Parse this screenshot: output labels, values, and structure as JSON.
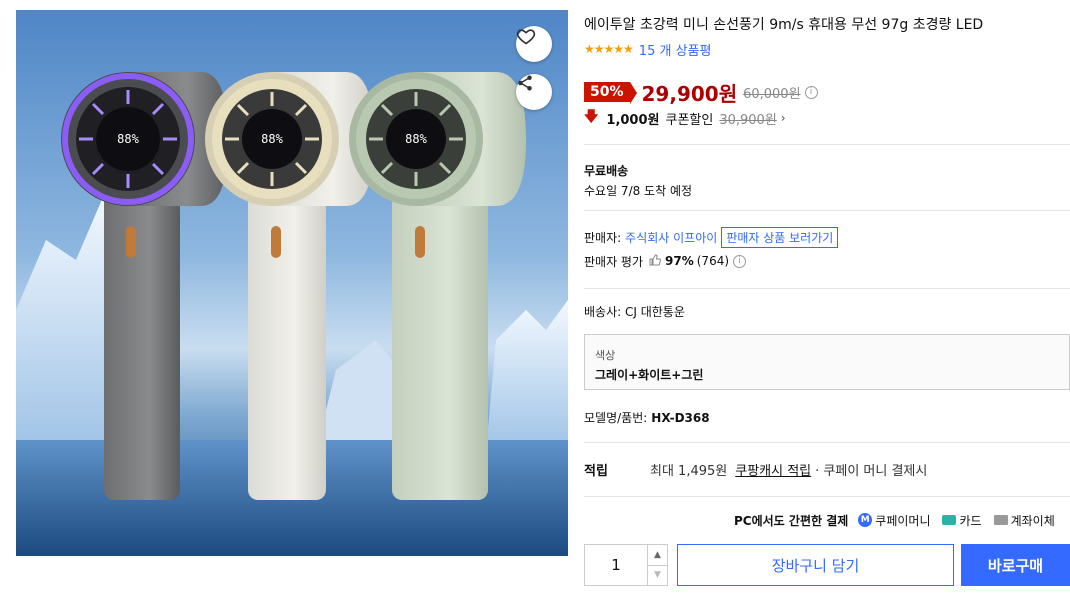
{
  "product": {
    "title": "에이투알 초강력 미니 손선풍기 9m/s 휴대용 무선 97g 초경량 LED",
    "stars": "★★★★★",
    "review_count": "15 개 상품평"
  },
  "image": {
    "fans": [
      {
        "color": "gray",
        "ring": "#8b5cf6",
        "display": "88%"
      },
      {
        "color": "white",
        "ring": "#e8dfbe",
        "display": "88%"
      },
      {
        "color": "green",
        "ring": "#b9c8b1",
        "display": "88%"
      }
    ],
    "colors": {
      "sky": "#4f86c6",
      "ice": "#dbe9f6",
      "water": "#24568c"
    }
  },
  "price": {
    "discount": "50%",
    "sale": "29,900원",
    "original": "60,000원",
    "info_icon": "i"
  },
  "coupon": {
    "arrow": "🡇",
    "amount": "1,000원",
    "label": "쿠폰할인",
    "price": "30,900원",
    "chevron": "›"
  },
  "shipping": {
    "title": "무료배송",
    "eta": "수요일 7/8 도착 예정"
  },
  "seller": {
    "label": "판매자:",
    "name": "주식회사 이프아이",
    "link": "판매자 상품 보러가기",
    "rating_label": "판매자 평가",
    "rating_pct": "97%",
    "rating_count": "(764)"
  },
  "carrier": "배송사: CJ 대한통운",
  "option": {
    "label": "색상",
    "value": "그레이+화이트+그린"
  },
  "model": {
    "label": "모델명/품번:",
    "value": "HX-D368"
  },
  "reward": {
    "label": "적립",
    "amount": "최대 1,495원",
    "link": "쿠팡캐시 적립",
    "extra": "· 쿠페이 머니 결제시"
  },
  "payment": {
    "title": "PC에서도 간편한 결제",
    "coupay_icon": "M",
    "coupay": "쿠페이머니",
    "card": "카드",
    "bank": "계좌이체"
  },
  "purchase": {
    "quantity": "1",
    "up": "▲",
    "down": "▼",
    "cart": "장바구니 담기",
    "buy": "바로구매"
  },
  "colors": {
    "accent": "#346aff",
    "sale": "#ae0000",
    "badge": "#cb1400"
  }
}
